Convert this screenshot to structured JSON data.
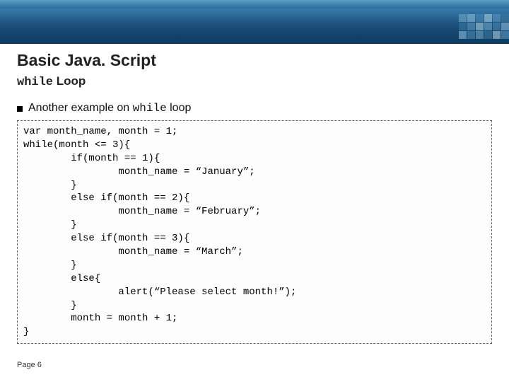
{
  "header": {
    "title": "Basic Java. Script",
    "subtitle_mono": "while",
    "subtitle_rest": " Loop"
  },
  "bullet": {
    "pre": "Another example on ",
    "mono": "while",
    "post": " loop"
  },
  "code": "var month_name, month = 1;\nwhile(month <= 3){\n        if(month == 1){\n                month_name = “January”;\n        }\n        else if(month == 2){\n                month_name = “February”;\n        }\n        else if(month == 3){\n                month_name = “March”;\n        }\n        else{\n                alert(“Please select month!”);\n        }\n        month = month + 1;\n}",
  "footer": {
    "page": "Page 6"
  },
  "colors": {
    "banner_dark": "#0d3a5f",
    "banner_mid": "#1a4d7a",
    "banner_light": "#3a7aab"
  }
}
